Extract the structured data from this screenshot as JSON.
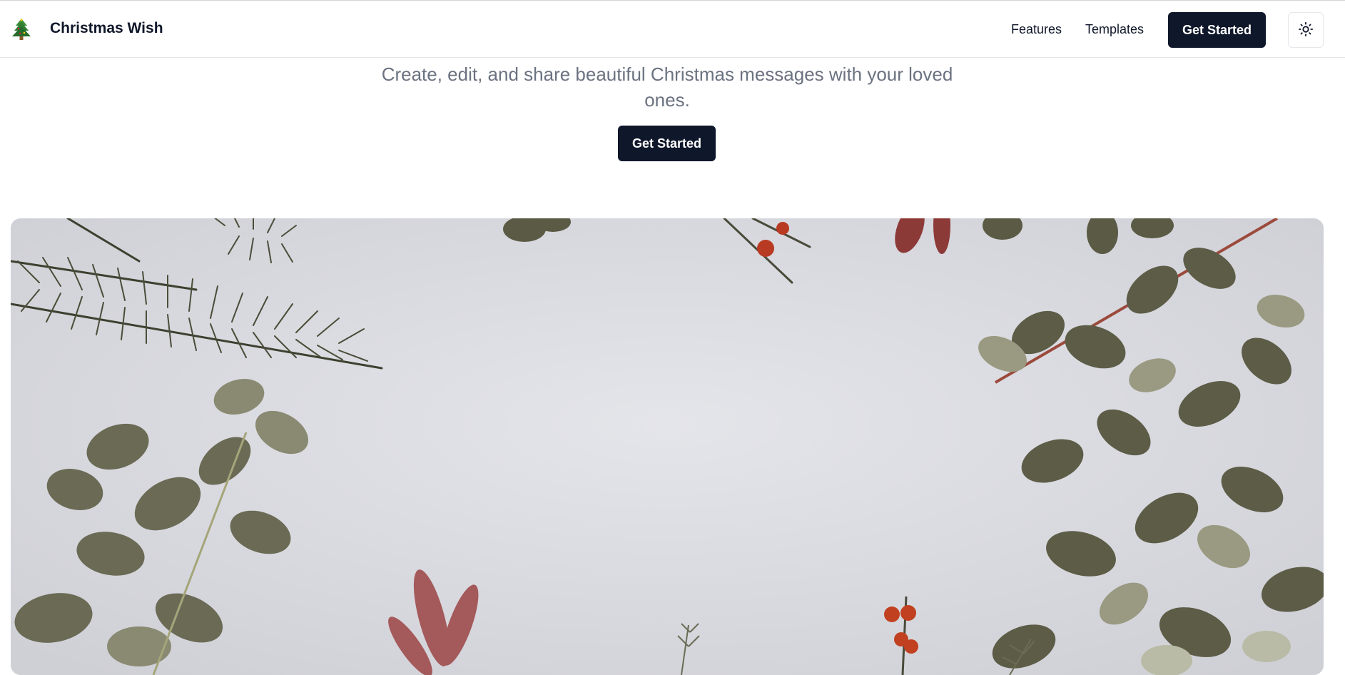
{
  "header": {
    "logo_icon": "christmas-tree-icon",
    "brand": "Christmas Wish",
    "nav": {
      "features": "Features",
      "templates": "Templates"
    },
    "cta_label": "Get Started",
    "theme_toggle_icon": "sun-icon"
  },
  "hero": {
    "subtitle": "Create, edit, and share beautiful Christmas messages with your loved ones.",
    "cta_label": "Get Started",
    "image_description_icon": "christmas-greenery-photo"
  },
  "colors": {
    "primary": "#0f172a",
    "muted_text": "#6b7280",
    "background": "#ffffff",
    "photo_backdrop": "#dcdde3"
  }
}
